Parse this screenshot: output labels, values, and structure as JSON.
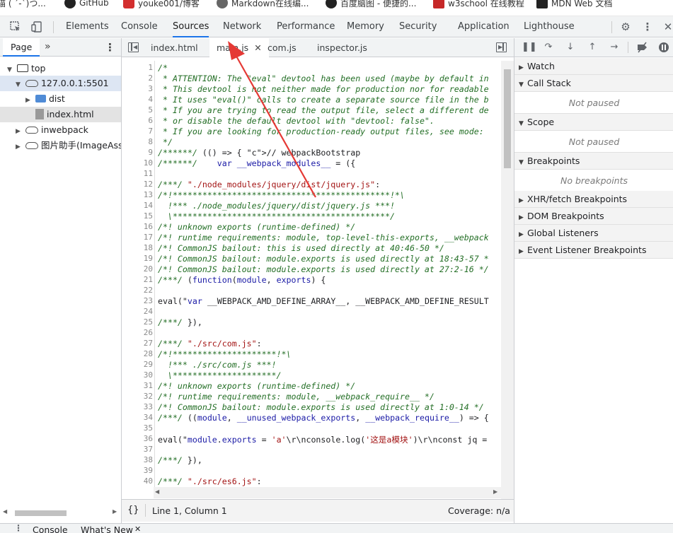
{
  "bookmarks": [
    {
      "label": "喵 ( ´-`)つ...",
      "icon": "emoji-icon"
    },
    {
      "label": "GitHub",
      "icon": "github-icon"
    },
    {
      "label": "youke001/博客",
      "icon": "blog-icon"
    },
    {
      "label": "Markdown在线编...",
      "icon": "markdown-icon"
    },
    {
      "label": "百度脑图 - 便捷的...",
      "icon": "baidu-mind-icon"
    },
    {
      "label": "w3school 在线教程",
      "icon": "w3school-icon"
    },
    {
      "label": "MDN Web 文档",
      "icon": "mdn-icon"
    }
  ],
  "devtools": {
    "tabs": [
      "Elements",
      "Console",
      "Sources",
      "Network",
      "Performance",
      "Memory",
      "Security",
      "Application",
      "Lighthouse"
    ],
    "active_tab": "Sources"
  },
  "navigator": {
    "tabs": [
      "Page"
    ],
    "more": "»",
    "tree": [
      {
        "label": "top",
        "depth": 0,
        "kind": "frame",
        "expanded": true
      },
      {
        "label": "127.0.0.1:5501",
        "depth": 1,
        "kind": "cloud",
        "expanded": true
      },
      {
        "label": "dist",
        "depth": 2,
        "kind": "folder",
        "expanded": false
      },
      {
        "label": "index.html",
        "depth": 2,
        "kind": "file",
        "selected": true
      },
      {
        "label": "inwebpack",
        "depth": 0,
        "kind": "cloud",
        "expanded": false
      },
      {
        "label": "图片助手(ImageAss",
        "depth": 0,
        "kind": "cloud",
        "expanded": false
      }
    ]
  },
  "editor": {
    "tabs": [
      {
        "label": "index.html",
        "active": false
      },
      {
        "label": "main.js",
        "active": true,
        "closable": true
      },
      {
        "label": "com.js",
        "active": false
      },
      {
        "label": "inspector.js",
        "active": false
      }
    ],
    "lines": [
      {
        "n": "1",
        "t": "/*",
        "c": "c"
      },
      {
        "n": "2",
        "t": " * ATTENTION: The \"eval\" devtool has been used (maybe by default in",
        "c": "c"
      },
      {
        "n": "3",
        "t": " * This devtool is not neither made for production nor for readable",
        "c": "c"
      },
      {
        "n": "4",
        "t": " * It uses \"eval()\" calls to create a separate source file in the b",
        "c": "c"
      },
      {
        "n": "5",
        "t": " * If you are trying to read the output file, select a different de",
        "c": "c"
      },
      {
        "n": "6",
        "t": " * or disable the default devtool with \"devtool: false\".",
        "c": "c"
      },
      {
        "n": "7",
        "t": " * If you are looking for production-ready output files, see mode:",
        "c": "c"
      },
      {
        "n": "8",
        "t": " */",
        "c": "c"
      },
      {
        "n": "9",
        "t": "/******/ (() => { // webpackBootstrap",
        "c": "mix1"
      },
      {
        "n": "10",
        "t": "/******/    var __webpack_modules__ = ({",
        "c": "mix2"
      },
      {
        "n": "11",
        "t": "",
        "c": "p"
      },
      {
        "n": "12",
        "t": "/***/ \"./node_modules/jquery/dist/jquery.js\":",
        "c": "mix3"
      },
      {
        "n": "13",
        "t": "/*!********************************************!*\\",
        "c": "c"
      },
      {
        "n": "14",
        "t": "  !*** ./node_modules/jquery/dist/jquery.js ***!",
        "c": "c"
      },
      {
        "n": "15",
        "t": "  \\********************************************/",
        "c": "c"
      },
      {
        "n": "16",
        "t": "/*! unknown exports (runtime-defined) */",
        "c": "c"
      },
      {
        "n": "17",
        "t": "/*! runtime requirements: module, top-level-this-exports, __webpack",
        "c": "c"
      },
      {
        "n": "18",
        "t": "/*! CommonJS bailout: this is used directly at 40:46-50 */",
        "c": "c"
      },
      {
        "n": "19",
        "t": "/*! CommonJS bailout: module.exports is used directly at 18:43-57 *",
        "c": "c"
      },
      {
        "n": "20",
        "t": "/*! CommonJS bailout: module.exports is used directly at 27:2-16 */",
        "c": "c"
      },
      {
        "n": "21",
        "t": "/***/ (function(module, exports) {",
        "c": "mix4"
      },
      {
        "n": "22",
        "t": "",
        "c": "p"
      },
      {
        "n": "23",
        "t": "eval(\"var __WEBPACK_AMD_DEFINE_ARRAY__, __WEBPACK_AMD_DEFINE_RESULT",
        "c": "mix5"
      },
      {
        "n": "24",
        "t": "",
        "c": "p"
      },
      {
        "n": "25",
        "t": "/***/ }),",
        "c": "mix6"
      },
      {
        "n": "26",
        "t": "",
        "c": "p"
      },
      {
        "n": "27",
        "t": "/***/ \"./src/com.js\":",
        "c": "mix3"
      },
      {
        "n": "28",
        "t": "/*!*********************!*\\",
        "c": "c"
      },
      {
        "n": "29",
        "t": "  !*** ./src/com.js ***!",
        "c": "c"
      },
      {
        "n": "30",
        "t": "  \\*********************/",
        "c": "c"
      },
      {
        "n": "31",
        "t": "/*! unknown exports (runtime-defined) */",
        "c": "c"
      },
      {
        "n": "32",
        "t": "/*! runtime requirements: module, __webpack_require__ */",
        "c": "c"
      },
      {
        "n": "33",
        "t": "/*! CommonJS bailout: module.exports is used directly at 1:0-14 */",
        "c": "c"
      },
      {
        "n": "34",
        "t": "/***/ ((module, __unused_webpack_exports, __webpack_require__) => {",
        "c": "mix4"
      },
      {
        "n": "35",
        "t": "",
        "c": "p"
      },
      {
        "n": "36",
        "t": "eval(\"module.exports = 'a'\\r\\nconsole.log('这是a模块')\\r\\nconst jq =",
        "c": "mix5"
      },
      {
        "n": "37",
        "t": "",
        "c": "p"
      },
      {
        "n": "38",
        "t": "/***/ }),",
        "c": "mix6"
      },
      {
        "n": "39",
        "t": "",
        "c": "p"
      },
      {
        "n": "40",
        "t": "/***/ \"./src/es6.js\":",
        "c": "mix3"
      },
      {
        "n": "41",
        "t": "",
        "c": "p"
      }
    ]
  },
  "statusbar": {
    "braces": "{}",
    "position": "Line 1, Column 1",
    "coverage": "Coverage: n/a"
  },
  "debugger": {
    "sections": [
      {
        "title": "Watch",
        "expanded": false
      },
      {
        "title": "Call Stack",
        "expanded": true,
        "body": "Not paused"
      },
      {
        "title": "Scope",
        "expanded": true,
        "body": "Not paused"
      },
      {
        "title": "Breakpoints",
        "expanded": true,
        "body": "No breakpoints"
      },
      {
        "title": "XHR/fetch Breakpoints",
        "expanded": false
      },
      {
        "title": "DOM Breakpoints",
        "expanded": false
      },
      {
        "title": "Global Listeners",
        "expanded": false
      },
      {
        "title": "Event Listener Breakpoints",
        "expanded": false
      }
    ]
  },
  "drawer": {
    "tabs": [
      "Console",
      "What's New"
    ]
  },
  "colors": {
    "accent": "#1a73e8",
    "annotation_arrow": "#e53935",
    "comment": "#236e25",
    "string": "#a31515",
    "keyword": "#1a1aa6"
  }
}
